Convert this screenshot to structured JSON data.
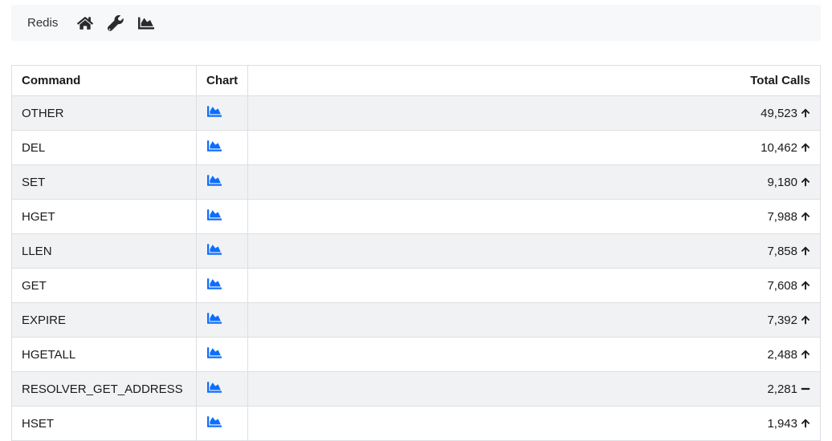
{
  "header": {
    "title": "Redis"
  },
  "table": {
    "columns": {
      "command": "Command",
      "chart": "Chart",
      "total": "Total Calls"
    },
    "rows": [
      {
        "command": "OTHER",
        "total": "49,523",
        "trend": "up"
      },
      {
        "command": "DEL",
        "total": "10,462",
        "trend": "up"
      },
      {
        "command": "SET",
        "total": "9,180",
        "trend": "up"
      },
      {
        "command": "HGET",
        "total": "7,988",
        "trend": "up"
      },
      {
        "command": "LLEN",
        "total": "7,858",
        "trend": "up"
      },
      {
        "command": "GET",
        "total": "7,608",
        "trend": "up"
      },
      {
        "command": "EXPIRE",
        "total": "7,392",
        "trend": "up"
      },
      {
        "command": "HGETALL",
        "total": "2,488",
        "trend": "up"
      },
      {
        "command": "RESOLVER_GET_ADDRESS",
        "total": "2,281",
        "trend": "flat"
      },
      {
        "command": "HSET",
        "total": "1,943",
        "trend": "up"
      }
    ]
  }
}
